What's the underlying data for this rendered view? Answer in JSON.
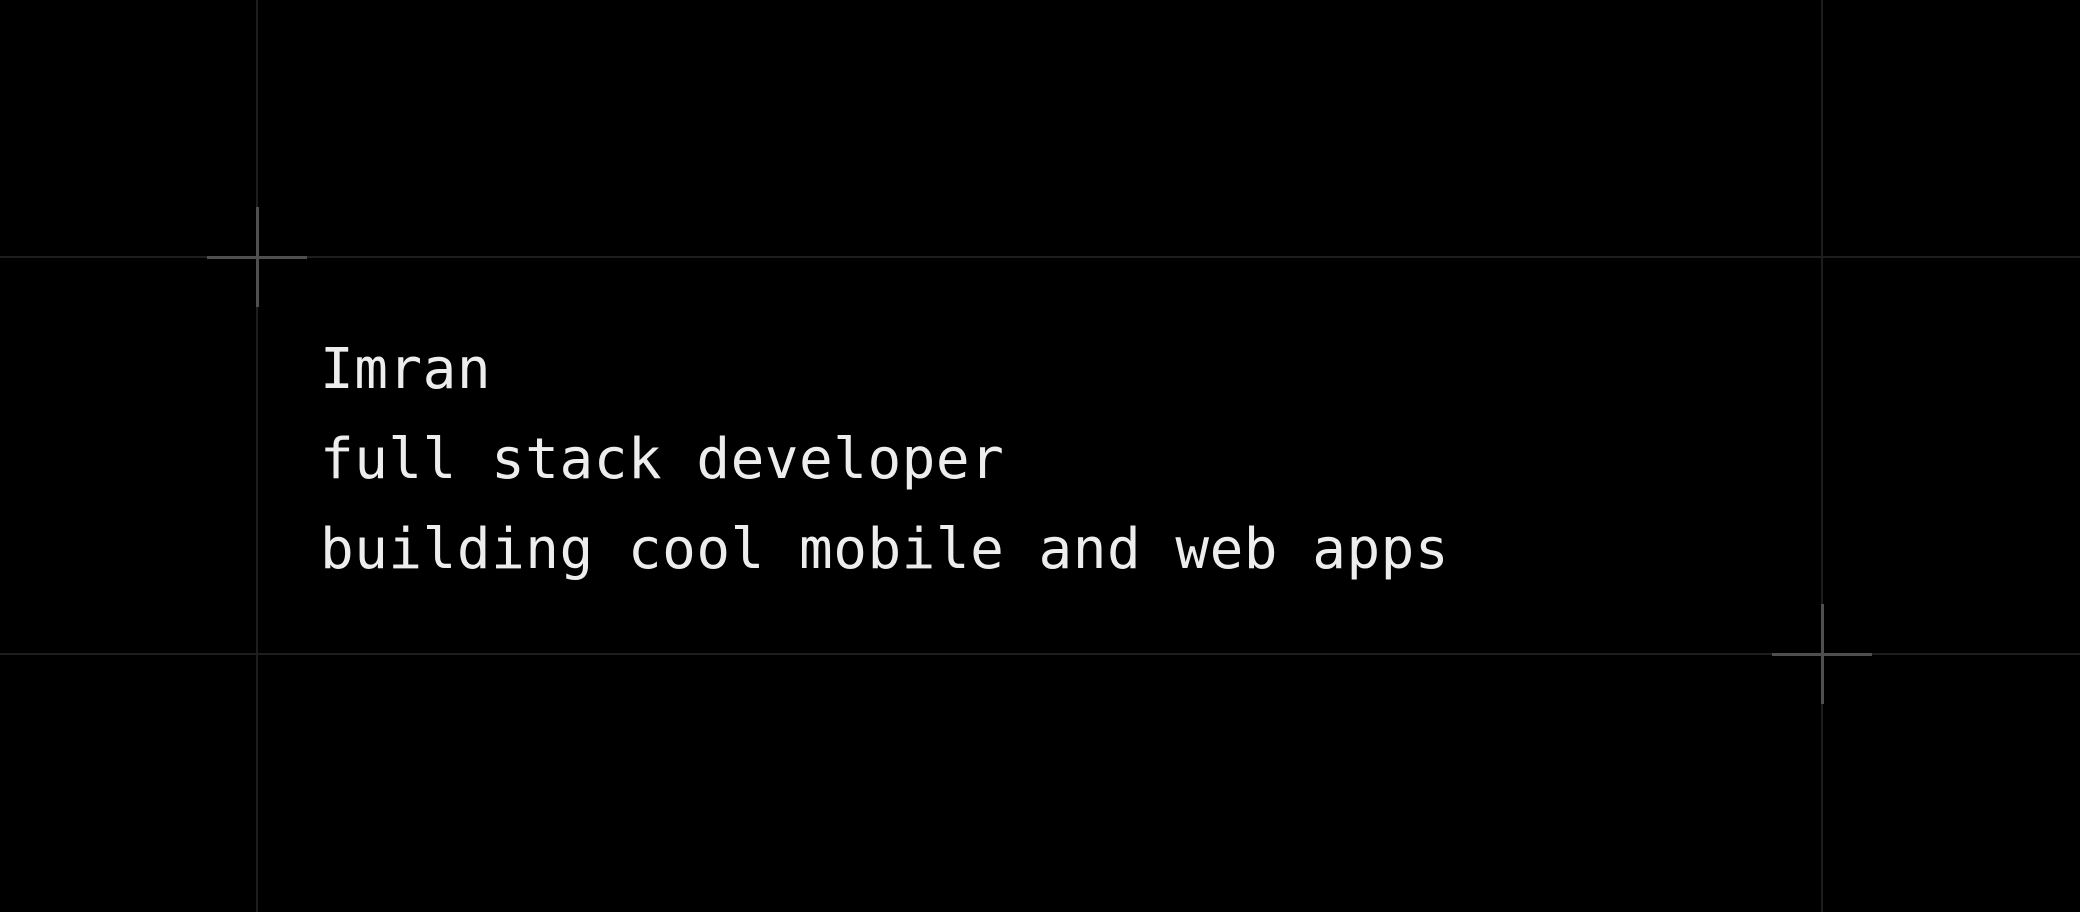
{
  "profile": {
    "name": "Imran",
    "role": "full stack developer",
    "tagline": "building cool mobile and web apps"
  },
  "theme": {
    "background": "#000000",
    "text": "#ededed",
    "grid_line": "#1e1e1e",
    "crosshair": "#4f4f4f"
  },
  "icons": [
    "crosshair-icon",
    "crosshair-icon"
  ]
}
